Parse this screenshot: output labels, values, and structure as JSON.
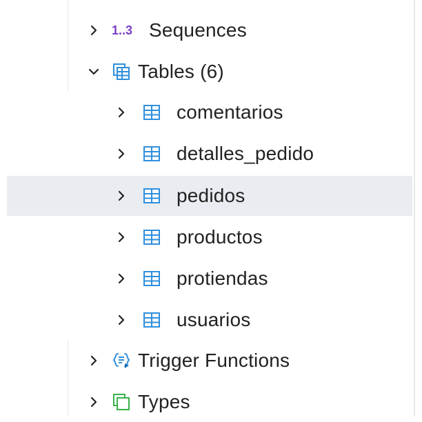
{
  "tree": {
    "sequences": {
      "icon_text": "1..3",
      "label": "Sequences",
      "icon": "sequence-icon",
      "expanded": false
    },
    "tables": {
      "label": "Tables",
      "count": "(6)",
      "icon": "tables-group-icon",
      "expanded": true,
      "items": [
        {
          "label": "comentarios",
          "icon": "table-icon",
          "selected": false
        },
        {
          "label": "detalles_pedido",
          "icon": "table-icon",
          "selected": false
        },
        {
          "label": "pedidos",
          "icon": "table-icon",
          "selected": true
        },
        {
          "label": "productos",
          "icon": "table-icon",
          "selected": false
        },
        {
          "label": "protiendas",
          "icon": "table-icon",
          "selected": false
        },
        {
          "label": "usuarios",
          "icon": "table-icon",
          "selected": false
        }
      ]
    },
    "trigger_functions": {
      "label": "Trigger Functions",
      "icon": "trigger-function-icon",
      "expanded": false
    },
    "types": {
      "label": "Types",
      "icon": "types-icon",
      "expanded": false
    }
  },
  "colors": {
    "table_icon": "#2f8fdc",
    "sequence_icon": "#7b3fc4",
    "types_icon": "#38b24a",
    "selected_row": "#e9ecf1"
  }
}
